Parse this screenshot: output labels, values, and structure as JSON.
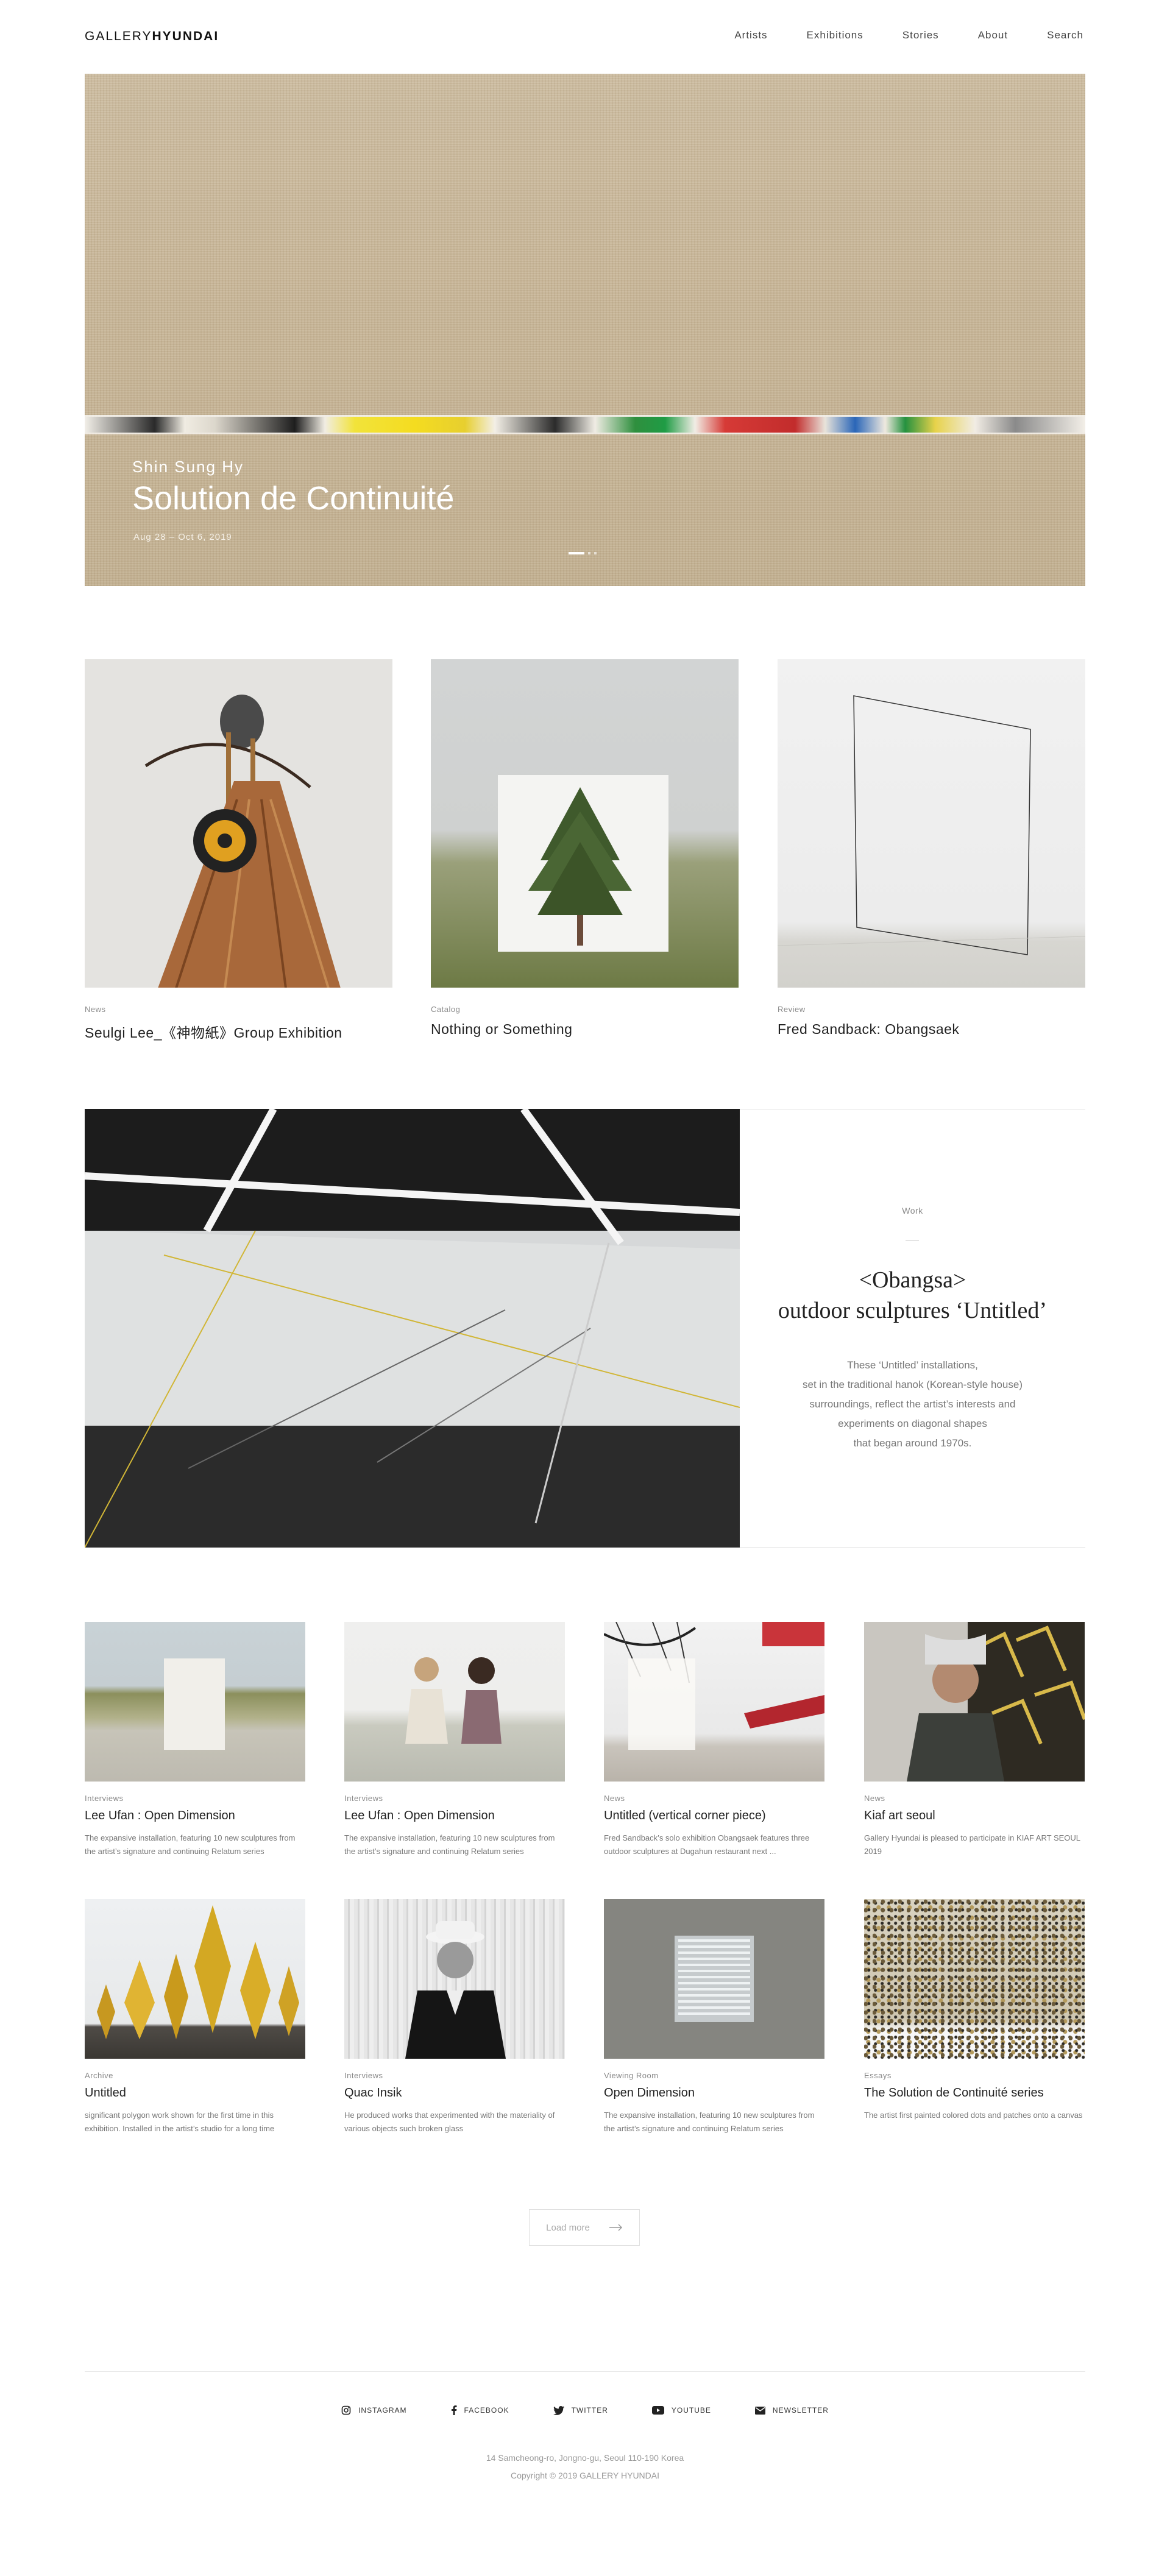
{
  "header": {
    "logo_light": "GALLERY",
    "logo_bold": "HYUNDAI",
    "nav": [
      "Artists",
      "Exhibitions",
      "Stories",
      "About",
      "Search"
    ]
  },
  "hero": {
    "artist": "Shin Sung Hy",
    "title": "Solution de Continuité",
    "date": "Aug 28 – Oct 6, 2019"
  },
  "features": [
    {
      "category": "News",
      "title": "Seulgi Lee_《神物紙》Group Exhibition"
    },
    {
      "category": "Catalog",
      "title": "Nothing or Something"
    },
    {
      "category": "Review",
      "title": "Fred Sandback: Obangsaek"
    }
  ],
  "work": {
    "category": "Work",
    "title_line1": "<Obangsa>",
    "title_line2": "outdoor sculptures ‘Untitled’",
    "desc_lines": [
      "These ‘Untitled’ installations,",
      "set in the traditional hanok (Korean-style house)",
      "surroundings, reflect the artist’s interests and",
      "experiments on diagonal shapes",
      "that began around 1970s."
    ]
  },
  "cards": [
    {
      "category": "Interviews",
      "title": "Lee Ufan : Open Dimension",
      "desc": "The expansive installation, featuring 10 new sculptures from the artist’s signature and continuing Relatum series"
    },
    {
      "category": "Interviews",
      "title": "Lee Ufan : Open Dimension",
      "desc": "The expansive installation, featuring 10 new sculptures from the artist’s signature and continuing Relatum series"
    },
    {
      "category": "News",
      "title": "Untitled (vertical corner piece)",
      "desc": "Fred Sandback’s solo exhibition Obangsaek features three outdoor sculptures at Dugahun restaurant next ..."
    },
    {
      "category": "News",
      "title": "Kiaf art seoul",
      "desc": "Gallery Hyundai is pleased to participate in KIAF ART SEOUL 2019"
    },
    {
      "category": "Archive",
      "title": "Untitled",
      "desc": "significant polygon work shown for the first time in this exhibition. Installed in the artist’s studio for a long time"
    },
    {
      "category": "Interviews",
      "title": "Quac Insik",
      "desc": "He produced works that experimented with the materiality of various objects such broken glass"
    },
    {
      "category": "Viewing Room",
      "title": "Open Dimension",
      "desc": "The expansive installation, featuring 10 new sculptures from the artist’s signature and continuing Relatum series"
    },
    {
      "category": "Essays",
      "title": "The Solution de Continuité series",
      "desc": "The artist first painted colored dots and patches onto a canvas"
    }
  ],
  "load_more": "Load more",
  "footer": {
    "social": [
      "INSTAGRAM",
      "FACEBOOK",
      "TWITTER",
      "YOUTUBE",
      "NEWSLETTER"
    ],
    "address": "14 Samcheong-ro, Jongno-gu, Seoul 110-190 Korea",
    "copyright": "Copyright © 2019 GALLERY HYUNDAI"
  },
  "colors": {
    "accent": "#222222",
    "muted": "#888888",
    "rule": "#e4e4e4"
  }
}
